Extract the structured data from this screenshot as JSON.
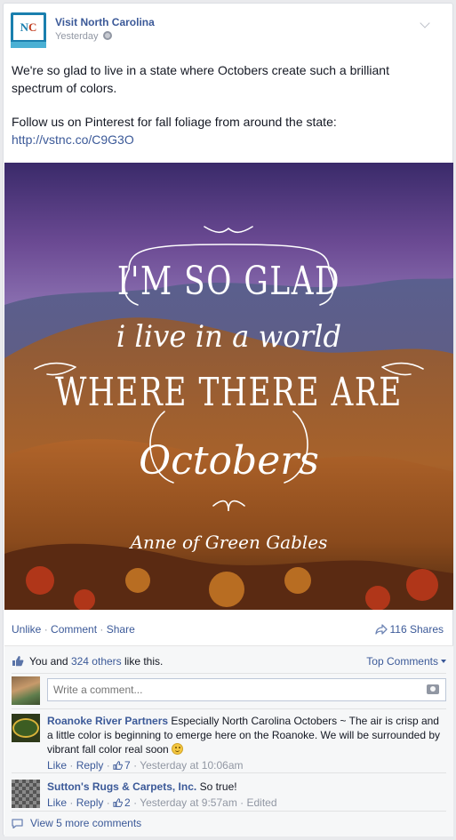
{
  "post": {
    "page_name": "Visit North Carolina",
    "avatar_text_n": "N",
    "avatar_text_c": "C",
    "time": "Yesterday",
    "text_line1": "We're so glad to live in a state where Octobers create such a brilliant spectrum of colors.",
    "text_line2": "Follow us on Pinterest for fall foliage from around the state:",
    "link": "http://vstnc.co/C9G3O"
  },
  "image_quote": {
    "line1": "I'M SO GLAD",
    "line2": "i live in a world",
    "line3": "WHERE THERE ARE",
    "line4": "Octobers",
    "attribution": "Anne of Green Gables"
  },
  "actions": {
    "unlike": "Unlike",
    "comment": "Comment",
    "share": "Share",
    "shares_count": "116 Shares"
  },
  "likes": {
    "prefix": "You and ",
    "others": "324 others",
    "suffix": " like this.",
    "top_comments": "Top Comments"
  },
  "comment_box": {
    "placeholder": "Write a comment..."
  },
  "comments": [
    {
      "author": "Roanoke River Partners",
      "text": "Especially North Carolina Octobers ~ The air is crisp and a little color is beginning to emerge here on the Roanoke. We will be surrounded by vibrant fall color real soon",
      "like": "Like",
      "reply": "Reply",
      "likes": "7",
      "time": "Yesterday at 10:06am"
    },
    {
      "author": "Sutton's Rugs & Carpets, Inc.",
      "text": "So true!",
      "like": "Like",
      "reply": "Reply",
      "likes": "2",
      "time": "Yesterday at 9:57am",
      "edited": "Edited"
    }
  ],
  "more_comments": "View 5 more comments",
  "colors": {
    "link": "#3b5998",
    "meta": "#9197a3",
    "background": "#e9eaed"
  }
}
